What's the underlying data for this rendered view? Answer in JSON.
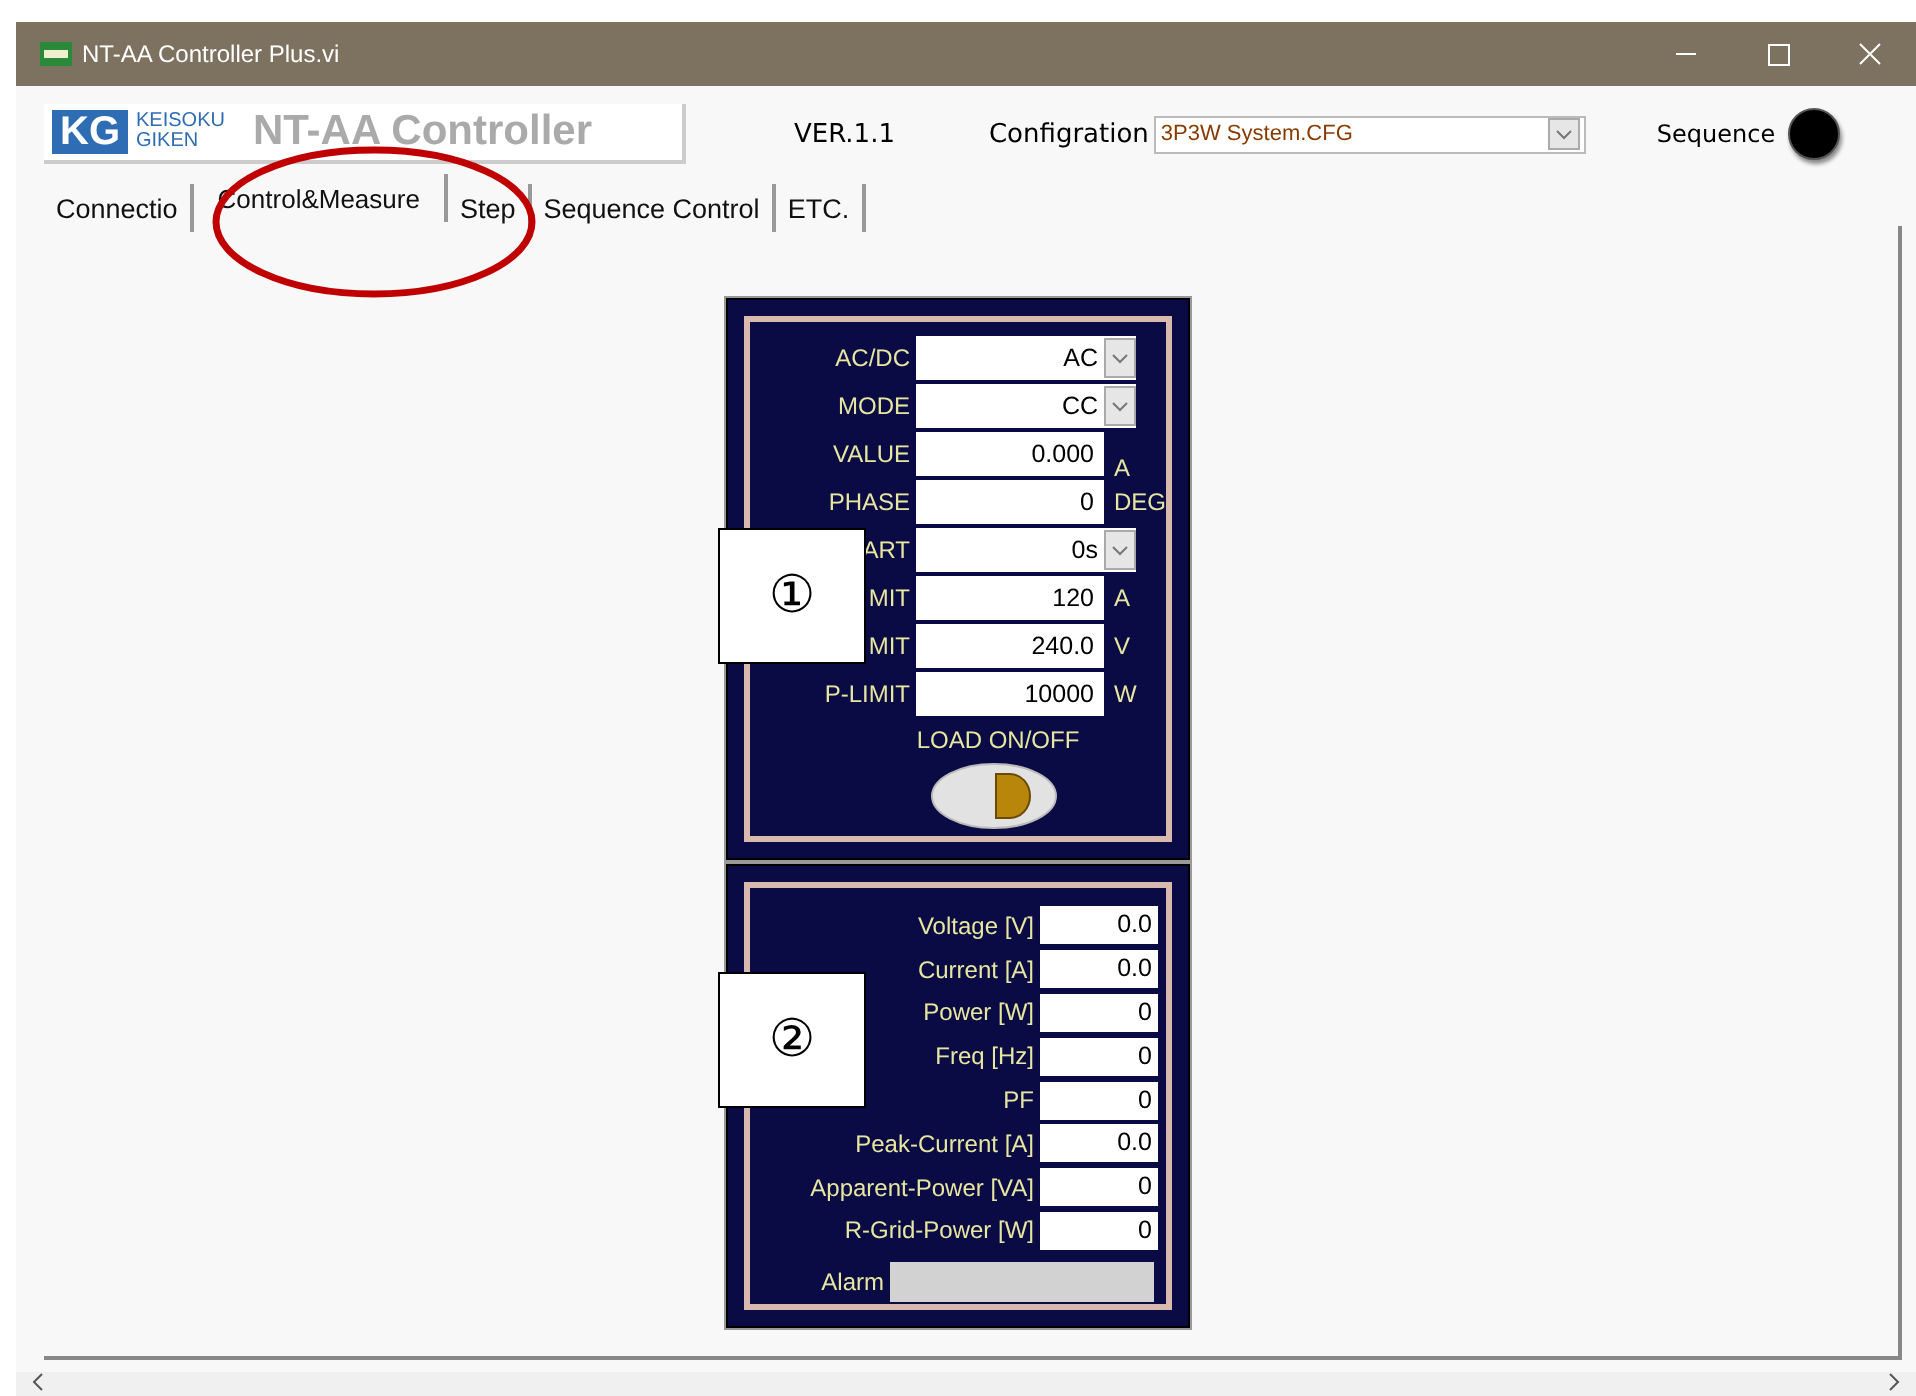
{
  "window": {
    "title": "NT-AA Controller Plus.vi"
  },
  "header": {
    "logo_mark": "KG",
    "logo_company_top": "KEISOKU",
    "logo_company_bottom": "GIKEN",
    "app_title": "NT-AA Controller",
    "version": "VER.1.1",
    "config_label": "Configration",
    "config_value": "3P3W System.CFG",
    "sequence_label": "Sequence",
    "sequence_led_on": false
  },
  "tabs": [
    {
      "label": "Connectio",
      "selected": false
    },
    {
      "label": "Control&Measure",
      "selected": true
    },
    {
      "label": "Step",
      "selected": false
    },
    {
      "label": "Sequence Control",
      "selected": false
    },
    {
      "label": "ETC.",
      "selected": false
    }
  ],
  "control_panel": {
    "rows": [
      {
        "kind": "dropdown",
        "label": "AC/DC",
        "value": "AC"
      },
      {
        "kind": "dropdown",
        "label": "MODE",
        "value": "CC"
      },
      {
        "kind": "numeric",
        "label": "VALUE",
        "value": "0.000",
        "unit": "A"
      },
      {
        "kind": "numeric",
        "label": "PHASE",
        "value": "0",
        "unit": "DEG"
      },
      {
        "kind": "dropdown",
        "label": "ART",
        "value": "0s"
      },
      {
        "kind": "numeric",
        "label": "MIT",
        "value": "120",
        "unit": "A"
      },
      {
        "kind": "numeric",
        "label": "MIT",
        "value": "240.0",
        "unit": "V"
      },
      {
        "kind": "numeric",
        "label": "P-LIMIT",
        "value": "10000",
        "unit": "W"
      }
    ],
    "load_label": "LOAD ON/OFF",
    "load_on": false
  },
  "measure_panel": {
    "rows": [
      {
        "label": "Voltage [V]",
        "value": "0.0"
      },
      {
        "label": "Current [A]",
        "value": "0.0"
      },
      {
        "label": "Power [W]",
        "value": "0"
      },
      {
        "label": "Freq [Hz]",
        "value": "0"
      },
      {
        "label": "PF",
        "value": "0"
      },
      {
        "label": "Peak-Current [A]",
        "value": "0.0"
      },
      {
        "label": "Apparent-Power [VA]",
        "value": "0"
      },
      {
        "label": "R-Grid-Power [W]",
        "value": "0"
      }
    ],
    "alarm_label": "Alarm",
    "alarm_on": false
  },
  "callouts": [
    {
      "label": "①"
    },
    {
      "label": "②"
    }
  ]
}
